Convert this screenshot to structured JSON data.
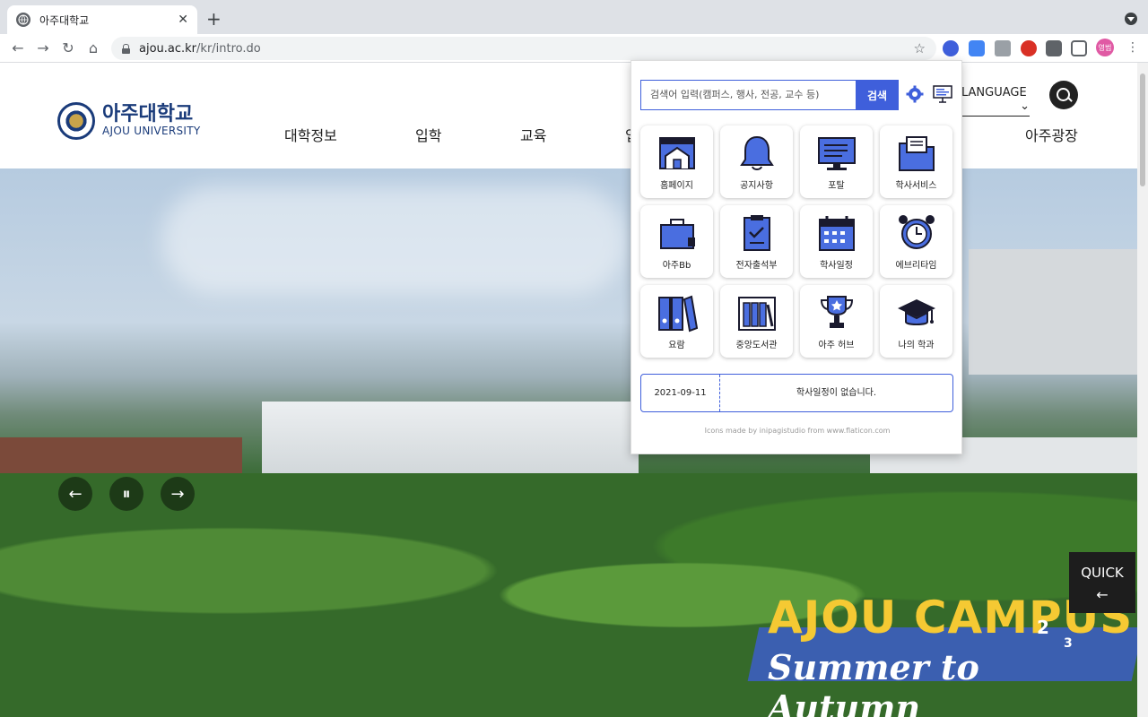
{
  "browser": {
    "tab_title": "아주대학교",
    "tab_close": "✕",
    "new_tab": "+",
    "url_host": "ajou.ac.kr",
    "url_path": "/kr/intro.do",
    "profile_label": "영범"
  },
  "site": {
    "logo_kor": "아주대학교",
    "logo_eng": "AJOU UNIVERSITY",
    "nav": [
      "대학정보",
      "입학",
      "교육",
      "아주광장"
    ],
    "nav_partial": "입",
    "language": "LANGUAGE",
    "language_caret": "⌄",
    "hero": {
      "title": "AJOU CAMPUS",
      "subtitle": "Summer to Autumn",
      "page_current": "2",
      "page_total": "3"
    },
    "slider_prev": "←",
    "slider_pause": "⏸",
    "slider_next": "→",
    "quick": "QUICK",
    "quick_arrow": "←"
  },
  "popup": {
    "search_placeholder": "검색어 입력(캠퍼스, 행사, 전공, 교수 등)",
    "search_button": "검색",
    "shortcuts": [
      {
        "label": "홈페이지",
        "icon": "homepage-icon"
      },
      {
        "label": "공지사항",
        "icon": "bell-icon"
      },
      {
        "label": "포탈",
        "icon": "monitor-icon"
      },
      {
        "label": "학사서비스",
        "icon": "folder-icon"
      },
      {
        "label": "아주Bb",
        "icon": "briefcase-icon"
      },
      {
        "label": "전자출석부",
        "icon": "clipboard-icon"
      },
      {
        "label": "학사일정",
        "icon": "calendar-icon"
      },
      {
        "label": "에브리타임",
        "icon": "alarm-clock-icon"
      },
      {
        "label": "요람",
        "icon": "binders-icon"
      },
      {
        "label": "중앙도서관",
        "icon": "library-icon"
      },
      {
        "label": "아주 허브",
        "icon": "trophy-icon"
      },
      {
        "label": "나의 학과",
        "icon": "graduation-cap-icon"
      }
    ],
    "schedule": {
      "date": "2021-09-11",
      "message": "학사일정이 없습니다."
    },
    "credit": "Icons made by inipagistudio from www.flaticon.com"
  },
  "colors": {
    "accent": "#3f5fdb",
    "icon_fill": "#4a6ee0",
    "icon_stroke": "#1a1a2e",
    "logo": "#1a3b7a",
    "hero_title": "#f5c933"
  }
}
